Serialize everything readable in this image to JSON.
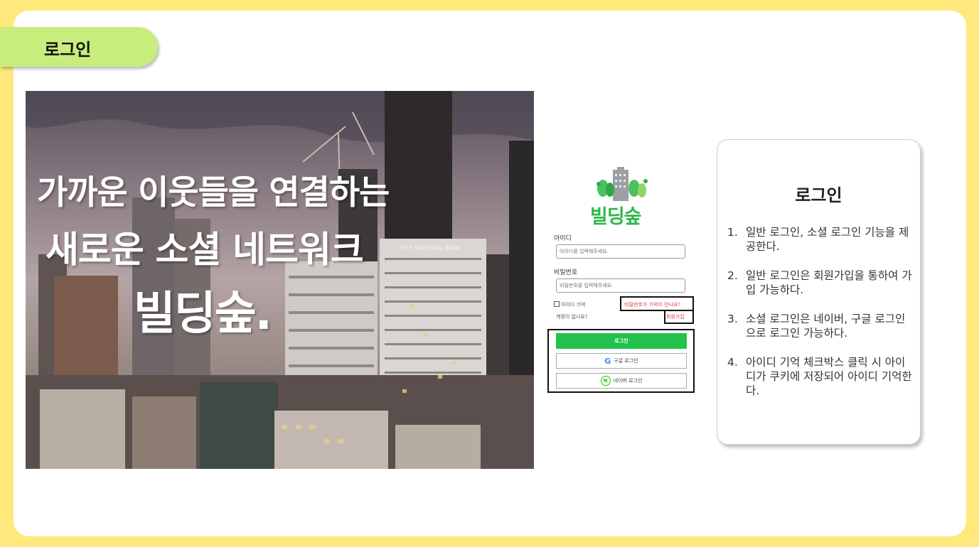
{
  "section_tag": "로그인",
  "hero": {
    "line1": "가까운 이웃들을 연결하는",
    "line2": "새로운 소셜 네트워크",
    "line3": "빌딩숲.",
    "bank_sign": "CITY NATIONAL BANK"
  },
  "login_form": {
    "logo_text": "빌딩숲",
    "id_label": "아이디",
    "id_placeholder": "아이디를 입력해주세요.",
    "pw_label": "비밀번호",
    "pw_placeholder": "비밀번호를 입력해주세요.",
    "remember_label": "아이디 기억",
    "forgot_link": "비밀번호가 기억이 안나요?",
    "no_account": "계정이 없나요?",
    "signup_link": "회원가입",
    "login_button": "로그인",
    "google_button": "구글 로그인",
    "naver_button": "네이버 로그인",
    "naver_badge": "N"
  },
  "description": {
    "title": "로그인",
    "items": [
      {
        "num": "1.",
        "text": "일반 로그인, 소셜 로그인 기능을 제공한다."
      },
      {
        "num": "2.",
        "text": "일반 로그인은 회원가입을 통하여 가입 가능하다."
      },
      {
        "num": "3.",
        "text": "소셜 로그인은 네이버, 구글 로그인으로 로그인 가능하다."
      },
      {
        "num": "4.",
        "text": "아이디 기억 체크박스 클릭 시 아이디가 쿠키에 저장되어 아이디 기억한다."
      }
    ]
  },
  "colors": {
    "background": "#ffe97d",
    "tag": "#c7ee7c",
    "brand_green": "#2db84b",
    "login_button": "#22c24c",
    "link_red": "#e13b3b"
  }
}
